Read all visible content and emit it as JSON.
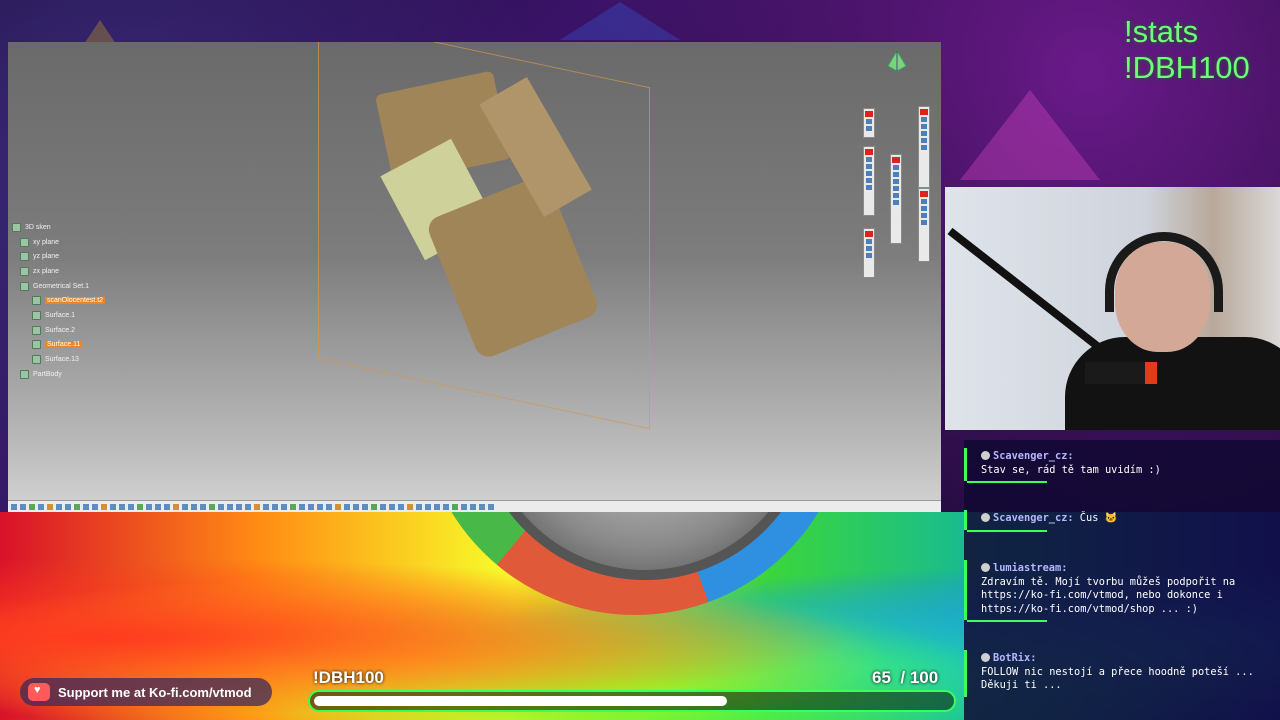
{
  "stats": {
    "line1": "!stats",
    "line2": "!DBH100"
  },
  "cad": {
    "tree": [
      {
        "label": "3D sken",
        "highlight": false,
        "indent": 0
      },
      {
        "label": "xy plane",
        "highlight": false,
        "indent": 1
      },
      {
        "label": "yz plane",
        "highlight": false,
        "indent": 1
      },
      {
        "label": "zx plane",
        "highlight": false,
        "indent": 1
      },
      {
        "label": "Geometrical Set.1",
        "highlight": false,
        "indent": 1
      },
      {
        "label": "scanOlocentest.t2",
        "highlight": true,
        "indent": 2
      },
      {
        "label": "Surface.1",
        "highlight": false,
        "indent": 2
      },
      {
        "label": "Surface.2",
        "highlight": false,
        "indent": 2
      },
      {
        "label": "Surface.11",
        "highlight": true,
        "indent": 2
      },
      {
        "label": "Surface.13",
        "highlight": false,
        "indent": 2
      },
      {
        "label": "PartBody",
        "highlight": false,
        "indent": 1
      }
    ]
  },
  "chat": {
    "messages": [
      {
        "user": "Scavenger_cz:",
        "text": "Stav se, rád tě tam uvidím :)"
      },
      {
        "user": "Scavenger_cz:",
        "text": "Čus 🐱"
      },
      {
        "user": "lumiastream:",
        "text": "Zdravím tě. Mojí tvorbu můžeš podpořit na https://ko-fi.com/vtmod, nebo dokonce i https://ko-fi.com/vtmod/shop ... :)"
      },
      {
        "user": "BotRix:",
        "text": "FOLLOW nic nestojí a přece hoodně poteší ... Děkuji ti ..."
      }
    ]
  },
  "goal": {
    "label": "!DBH100",
    "current": "65",
    "separator": "/",
    "target": "100",
    "progress": 0.65
  },
  "kofi": {
    "label": "Support me at Ko-fi.com/vtmod"
  },
  "colors": {
    "accent": "#37ff5c",
    "stats": "#6dff7a",
    "kofi": "#ff5a5a"
  }
}
